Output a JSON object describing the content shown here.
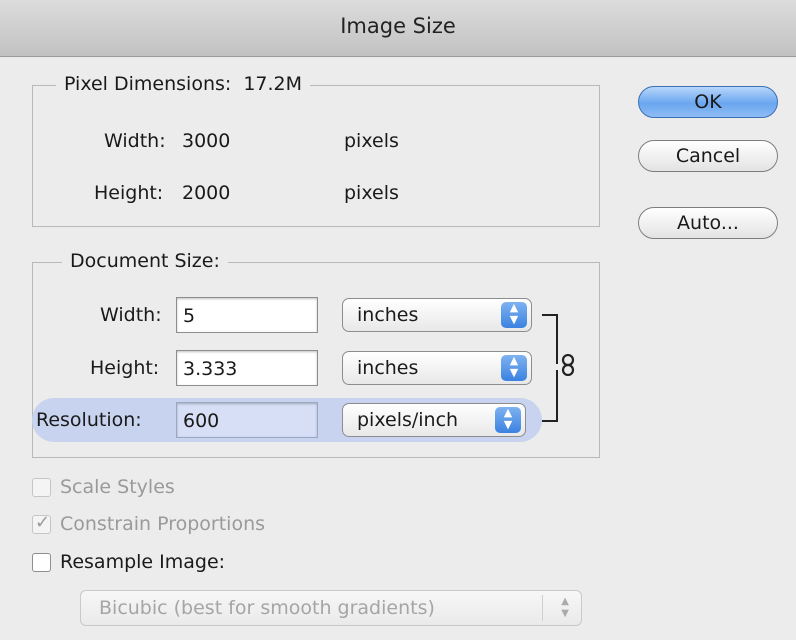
{
  "window": {
    "title": "Image Size"
  },
  "pixel_dimensions": {
    "label": "Pixel Dimensions:",
    "size": "17.2M",
    "width_label": "Width:",
    "width_value": "3000",
    "width_unit": "pixels",
    "height_label": "Height:",
    "height_value": "2000",
    "height_unit": "pixels"
  },
  "document_size": {
    "label": "Document Size:",
    "width_label": "Width:",
    "width_value": "5",
    "width_unit": "inches",
    "height_label": "Height:",
    "height_value": "3.333",
    "height_unit": "inches",
    "resolution_label": "Resolution:",
    "resolution_value": "600",
    "resolution_unit": "pixels/inch"
  },
  "buttons": {
    "ok": "OK",
    "cancel": "Cancel",
    "auto": "Auto..."
  },
  "options": {
    "scale_styles": {
      "label": "Scale Styles",
      "checked": false,
      "enabled": false
    },
    "constrain_proportions": {
      "label": "Constrain Proportions",
      "checked": true,
      "enabled": false
    },
    "resample_image": {
      "label": "Resample Image:",
      "checked": false,
      "enabled": true
    },
    "resample_method": "Bicubic (best for smooth gradients)"
  },
  "icons": {
    "link": "chain-link-icon",
    "popup_arrows": "updown-arrows-icon"
  },
  "colors": {
    "default_button": "#6aa6ef",
    "focus_highlight": "#c7d3ef",
    "popup_arrow": "#3a82e0"
  }
}
